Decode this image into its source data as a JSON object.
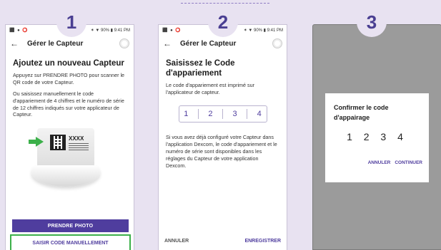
{
  "steps": [
    {
      "number": "1"
    },
    {
      "number": "2"
    },
    {
      "number": "3"
    }
  ],
  "status_bar": {
    "left": "⬛ ● ⭕",
    "right": "✶ ▼ 90% ▮ 9:41 PM"
  },
  "app": {
    "back_icon": "back-arrow-icon",
    "title": "Gérer le Capteur"
  },
  "screen1": {
    "heading": "Ajoutez un nouveau Capteur",
    "paragraph1": "Appuyez sur PRENDRE PHOTO pour scanner le QR code de votre Capteur.",
    "paragraph2": "Ou saisissez manuellement le code d'appariement de 4 chiffres et le numéro de série de 12 chiffres indiqués sur votre applicateur de Capteur.",
    "sensor_label": "XXXX",
    "photo_button": "PRENDRE PHOTO",
    "manual_button": "SAISIR CODE MANUELLEMENT"
  },
  "screen2": {
    "heading": "Saisissez le Code d'appariement",
    "paragraph1": "Le code d'appariement est imprimé sur l'applicateur de capteur.",
    "digits": [
      "1",
      "2",
      "3",
      "4"
    ],
    "paragraph2": "Si vous avez déjà configuré votre Capteur dans l'application Dexcom, le code d'appariement et le numéro de série sont disponibles dans les réglages du Capteur de votre application Dexcom.",
    "cancel": "ANNULER",
    "save": "ENREGISTRER"
  },
  "screen3": {
    "dialog_title": "Confirmer le code d'appairage",
    "code": "1 2 3 4",
    "cancel": "ANNULER",
    "continue": "CONTINUER"
  },
  "colors": {
    "accent": "#4f3d9e",
    "highlight": "#3cb04a",
    "background": "#e8e2f1",
    "badge_text": "#4a3f92"
  }
}
